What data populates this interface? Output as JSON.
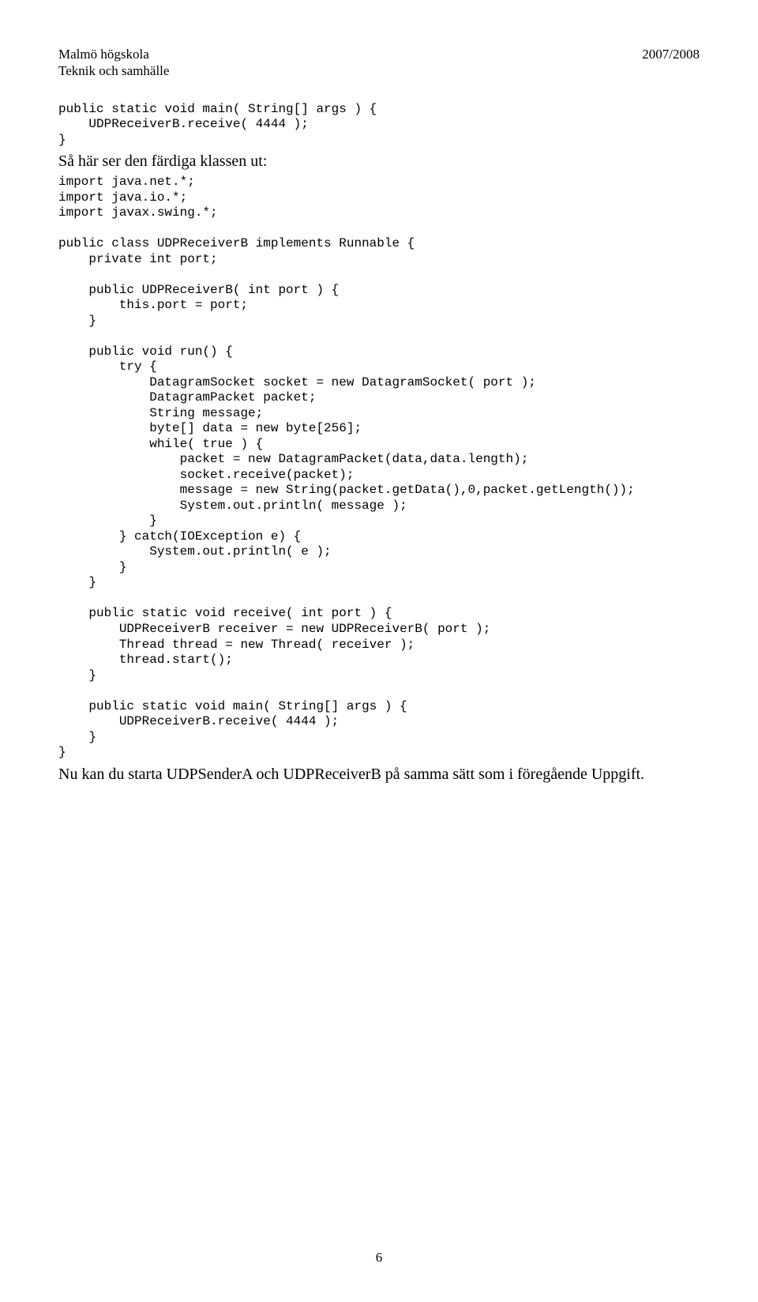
{
  "header": {
    "left_line1": "Malmö högskola",
    "left_line2": "Teknik och samhälle",
    "right_line1": "2007/2008"
  },
  "code_block_1": "public static void main( String[] args ) {\n    UDPReceiverB.receive( 4444 );\n}",
  "prose_1": "Så här ser den färdiga klassen ut:",
  "code_block_2": "import java.net.*;\nimport java.io.*;\nimport javax.swing.*;\n\npublic class UDPReceiverB implements Runnable {\n    private int port;\n\n    public UDPReceiverB( int port ) {\n        this.port = port;\n    }\n\n    public void run() {\n        try {\n            DatagramSocket socket = new DatagramSocket( port );\n            DatagramPacket packet;\n            String message;\n            byte[] data = new byte[256];\n            while( true ) {\n                packet = new DatagramPacket(data,data.length);\n                socket.receive(packet);\n                message = new String(packet.getData(),0,packet.getLength());\n                System.out.println( message );\n            }\n        } catch(IOException e) {\n            System.out.println( e );\n        }\n    }\n\n    public static void receive( int port ) {\n        UDPReceiverB receiver = new UDPReceiverB( port );\n        Thread thread = new Thread( receiver );\n        thread.start();\n    }\n\n    public static void main( String[] args ) {\n        UDPReceiverB.receive( 4444 );\n    }\n}",
  "prose_2": "Nu kan du starta UDPSenderA och UDPReceiverB på samma sätt som i föregående Uppgift.",
  "page_number": "6"
}
